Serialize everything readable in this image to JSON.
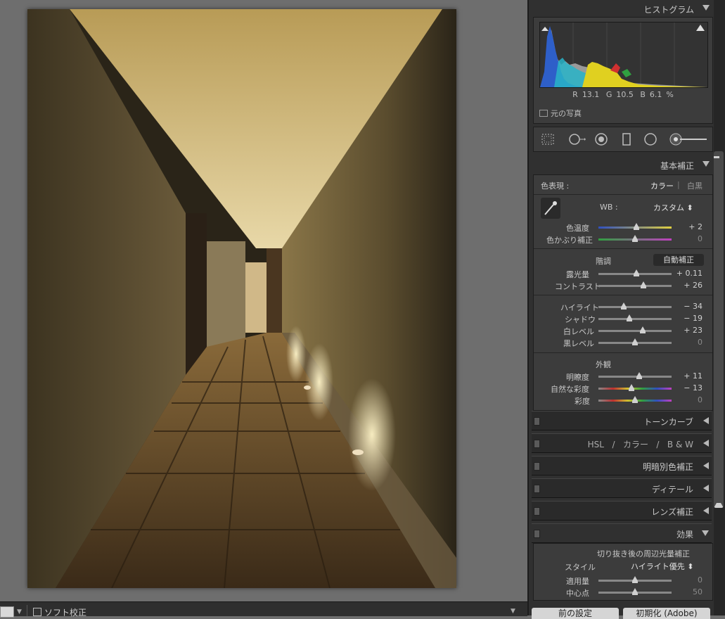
{
  "histogram": {
    "title": "ヒストグラム",
    "readout": {
      "r_label": "R",
      "r": "13.1",
      "g_label": "G",
      "g": "10.5",
      "b_label": "B",
      "b": "6.1",
      "pct": "%"
    },
    "original_photo_label": "元の写真"
  },
  "tools": [
    "crop-overlay",
    "spot-removal",
    "red-eye",
    "graduated-filter",
    "radial-filter",
    "adjustment-brush"
  ],
  "basic": {
    "title": "基本補正",
    "treatment_label": "色表現 :",
    "treatment_color": "カラー",
    "treatment_sep": "|",
    "treatment_bw": "白黒",
    "wb_label": "WB :",
    "wb_value": "カスタム ⬍",
    "temp": {
      "label": "色温度",
      "value": "+ 2",
      "pos": 0.52
    },
    "tint": {
      "label": "色かぶり補正",
      "value": "0",
      "pos": 0.5
    },
    "tone_label": "階調",
    "auto_label": "自動補正",
    "exposure": {
      "label": "露光量",
      "value": "+ 0.11",
      "pos": 0.52
    },
    "contrast": {
      "label": "コントラスト",
      "value": "+ 26",
      "pos": 0.62
    },
    "highlights": {
      "label": "ハイライト",
      "value": "− 34",
      "pos": 0.35
    },
    "shadows": {
      "label": "シャドウ",
      "value": "− 19",
      "pos": 0.42
    },
    "whites": {
      "label": "白レベル",
      "value": "+ 23",
      "pos": 0.61
    },
    "blacks": {
      "label": "黒レベル",
      "value": "0",
      "pos": 0.5
    },
    "presence_label": "外観",
    "clarity": {
      "label": "明瞭度",
      "value": "+ 11",
      "pos": 0.56
    },
    "vibrance": {
      "label": "自然な彩度",
      "value": "− 13",
      "pos": 0.45
    },
    "saturation": {
      "label": "彩度",
      "value": "0",
      "pos": 0.5
    }
  },
  "panels": {
    "tone_curve": "トーンカーブ",
    "hsl": "HSL",
    "hsl_sep1": "/",
    "hsl_color": "カラー",
    "hsl_sep2": "/",
    "hsl_bw": "B & W",
    "split": "明暗別色補正",
    "detail": "ディテール",
    "lens": "レンズ補正",
    "effects": "効果"
  },
  "effects": {
    "vignette_title": "切り抜き後の周辺光量補正",
    "style_label": "スタイル",
    "style_value": "ハイライト優先 ⬍",
    "amount": {
      "label": "適用量",
      "value": "0",
      "pos": 0.5
    },
    "midpoint": {
      "label": "中心点",
      "value": "50",
      "pos": 0.5
    }
  },
  "buttons": {
    "previous": "前の設定",
    "reset": "初期化 (Adobe)"
  },
  "toolbar": {
    "label": "ソフト校正"
  }
}
